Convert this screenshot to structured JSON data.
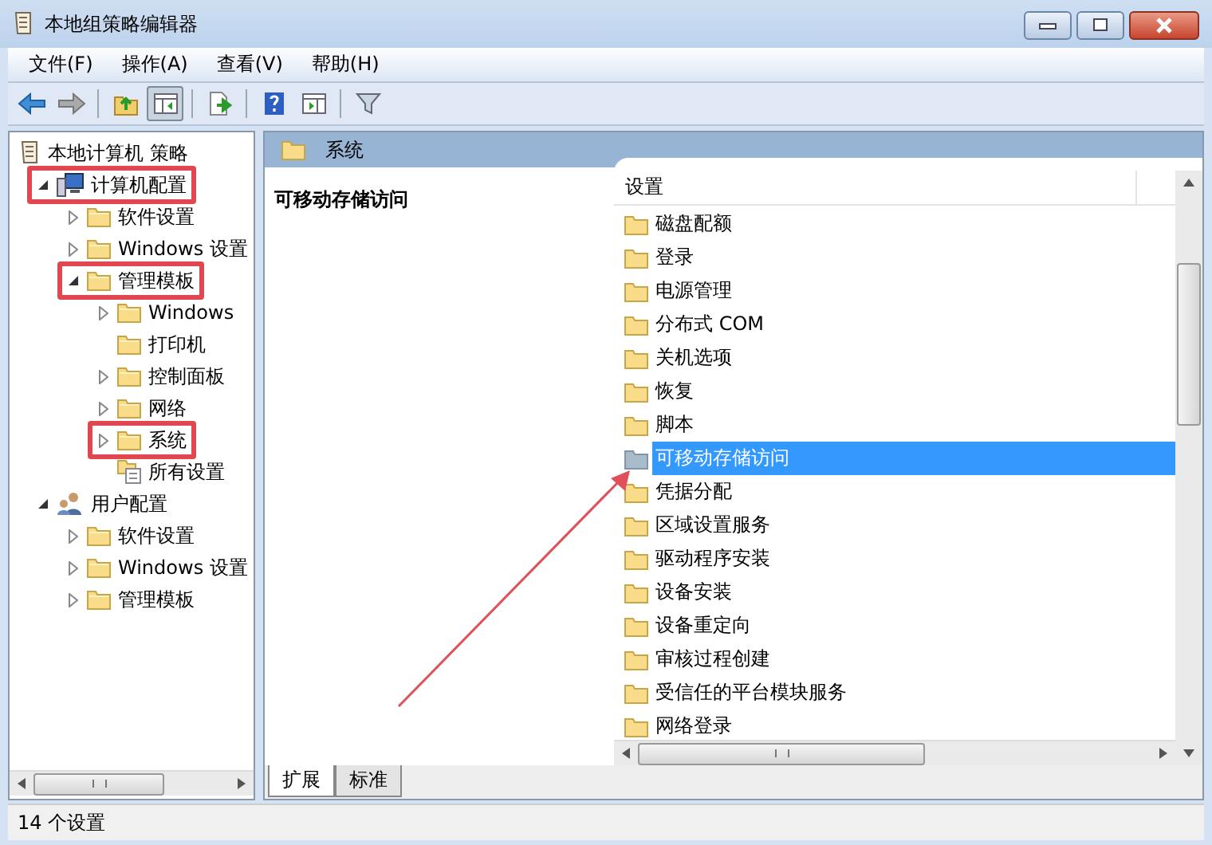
{
  "window": {
    "title": "本地组策略编辑器"
  },
  "menu": [
    "文件(F)",
    "操作(A)",
    "查看(V)",
    "帮助(H)"
  ],
  "toolbar": [
    {
      "kind": "back"
    },
    {
      "kind": "forward"
    },
    {
      "kind": "sep"
    },
    {
      "kind": "up"
    },
    {
      "kind": "tree",
      "pressed": true
    },
    {
      "kind": "sep"
    },
    {
      "kind": "export"
    },
    {
      "kind": "sep"
    },
    {
      "kind": "help"
    },
    {
      "kind": "panel"
    },
    {
      "kind": "sep"
    },
    {
      "kind": "filter"
    }
  ],
  "tree": [
    {
      "label": "本地计算机 策略",
      "kind": "policy",
      "highlighted": false,
      "children": [
        {
          "label": "计算机配置",
          "kind": "computer",
          "expanded": true,
          "highlighted": true,
          "children": [
            {
              "label": "软件设置",
              "kind": "folder",
              "expanded": false,
              "highlighted": false
            },
            {
              "label": "Windows 设置",
              "kind": "folder",
              "expanded": false,
              "highlighted": false
            },
            {
              "label": "管理模板",
              "kind": "folder",
              "expanded": true,
              "highlighted": true,
              "children": [
                {
                  "label": "Windows",
                  "kind": "folder",
                  "expanded": false,
                  "highlighted": false
                },
                {
                  "label": "打印机",
                  "kind": "folder",
                  "highlighted": false
                },
                {
                  "label": "控制面板",
                  "kind": "folder",
                  "expanded": false,
                  "highlighted": false
                },
                {
                  "label": "网络",
                  "kind": "folder",
                  "expanded": false,
                  "highlighted": false
                },
                {
                  "label": "系统",
                  "kind": "folder",
                  "expanded": false,
                  "highlighted": true
                },
                {
                  "label": "所有设置",
                  "kind": "all",
                  "highlighted": false
                }
              ]
            }
          ]
        },
        {
          "label": "用户配置",
          "kind": "user",
          "expanded": true,
          "highlighted": false,
          "children": [
            {
              "label": "软件设置",
              "kind": "folder",
              "expanded": false,
              "highlighted": false
            },
            {
              "label": "Windows 设置",
              "kind": "folder",
              "expanded": false,
              "highlighted": false
            },
            {
              "label": "管理模板",
              "kind": "folder",
              "expanded": false,
              "highlighted": false
            }
          ]
        }
      ]
    }
  ],
  "panel": {
    "title": "系统",
    "description_title": "可移动存储访问",
    "column": "设置",
    "items": [
      {
        "label": "磁盘配额",
        "selected": false
      },
      {
        "label": "登录",
        "selected": false
      },
      {
        "label": "电源管理",
        "selected": false
      },
      {
        "label": "分布式 COM",
        "selected": false
      },
      {
        "label": "关机选项",
        "selected": false
      },
      {
        "label": "恢复",
        "selected": false
      },
      {
        "label": "脚本",
        "selected": false
      },
      {
        "label": "可移动存储访问",
        "selected": true
      },
      {
        "label": "凭据分配",
        "selected": false
      },
      {
        "label": "区域设置服务",
        "selected": false
      },
      {
        "label": "驱动程序安装",
        "selected": false
      },
      {
        "label": "设备安装",
        "selected": false
      },
      {
        "label": "设备重定向",
        "selected": false
      },
      {
        "label": "审核过程创建",
        "selected": false
      },
      {
        "label": "受信任的平台模块服务",
        "selected": false
      },
      {
        "label": "网络登录",
        "selected": false
      }
    ],
    "tabs": [
      {
        "label": "扩展",
        "selected": true
      },
      {
        "label": "标准",
        "selected": false
      }
    ]
  },
  "status_bar": "14 个设置"
}
